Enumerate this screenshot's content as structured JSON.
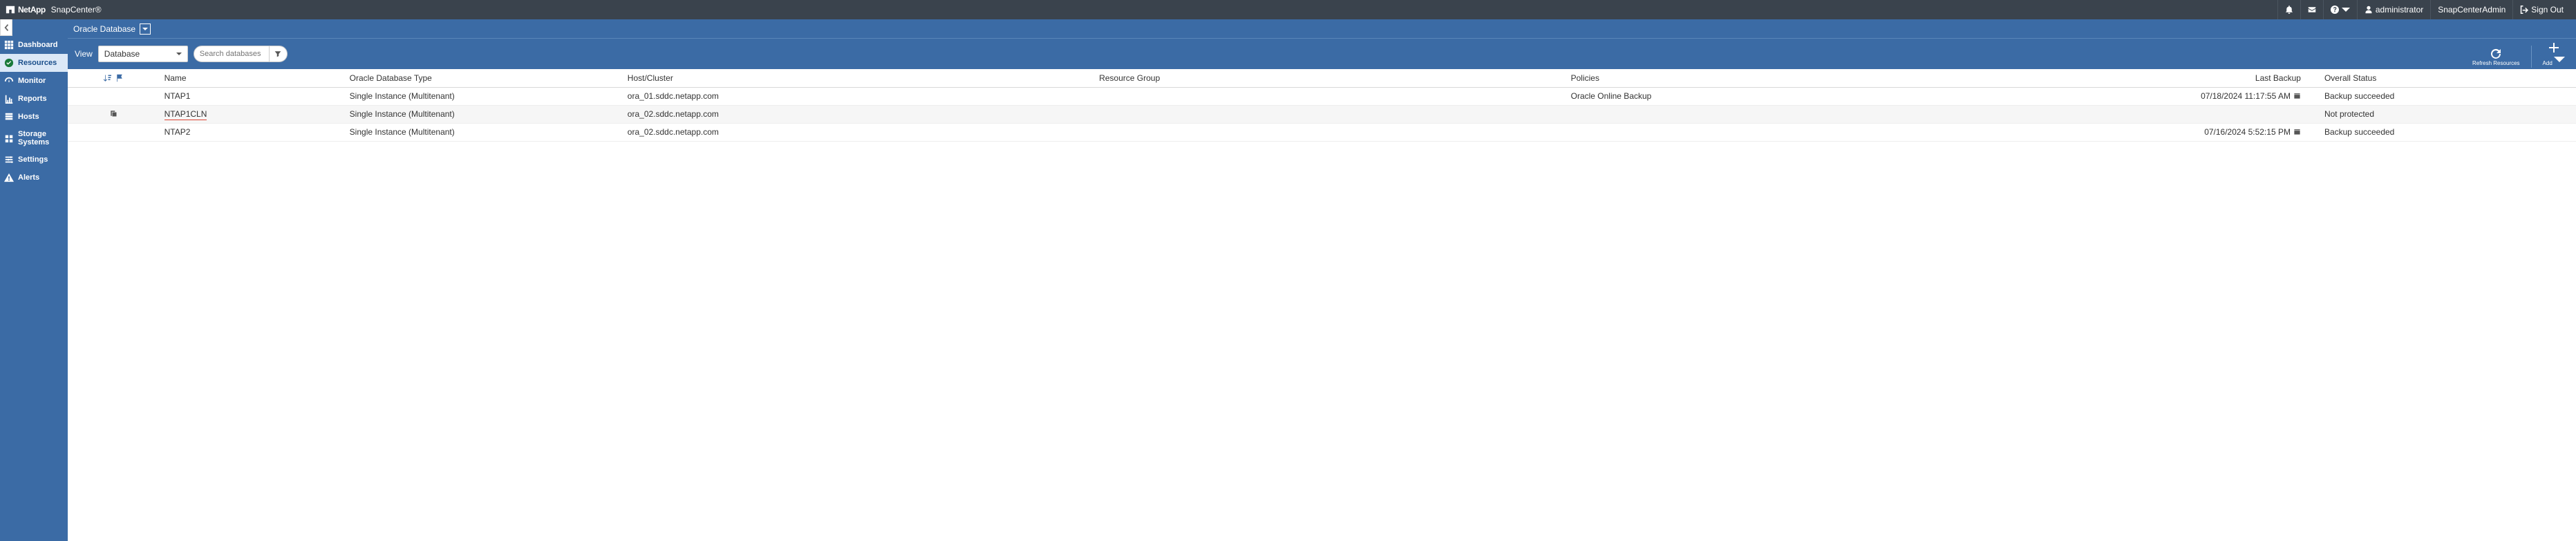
{
  "header": {
    "brand_prefix": "NetApp",
    "product": "SnapCenter®",
    "user_label": "administrator",
    "role_label": "SnapCenterAdmin",
    "signout_label": "Sign Out"
  },
  "sidebar": {
    "items": [
      {
        "id": "dashboard",
        "label": "Dashboard"
      },
      {
        "id": "resources",
        "label": "Resources"
      },
      {
        "id": "monitor",
        "label": "Monitor"
      },
      {
        "id": "reports",
        "label": "Reports"
      },
      {
        "id": "hosts",
        "label": "Hosts"
      },
      {
        "id": "storage",
        "label": "Storage Systems"
      },
      {
        "id": "settings",
        "label": "Settings"
      },
      {
        "id": "alerts",
        "label": "Alerts"
      }
    ],
    "active": "resources"
  },
  "breadcrumb": {
    "plugin": "Oracle Database"
  },
  "filterbar": {
    "view_label": "View",
    "view_value": "Database",
    "search_placeholder": "Search databases",
    "refresh_label": "Refresh Resources",
    "add_label": "Add"
  },
  "table": {
    "columns": {
      "name": "Name",
      "dbtype": "Oracle Database Type",
      "host": "Host/Cluster",
      "rg": "Resource Group",
      "policies": "Policies",
      "lastbackup": "Last Backup",
      "status": "Overall Status"
    },
    "rows": [
      {
        "row_icon": "none",
        "name": "NTAP1",
        "dbtype": "Single Instance (Multitenant)",
        "host": "ora_01.sddc.netapp.com",
        "rg": "",
        "policies": "Oracle Online Backup",
        "lastbackup": "07/18/2024 11:17:55 AM",
        "show_cal": true,
        "status": "Backup succeeded",
        "highlight_name": false
      },
      {
        "row_icon": "clone",
        "name": "NTAP1CLN",
        "dbtype": "Single Instance (Multitenant)",
        "host": "ora_02.sddc.netapp.com",
        "rg": "",
        "policies": "",
        "lastbackup": "",
        "show_cal": false,
        "status": "Not protected",
        "highlight_name": true
      },
      {
        "row_icon": "none",
        "name": "NTAP2",
        "dbtype": "Single Instance (Multitenant)",
        "host": "ora_02.sddc.netapp.com",
        "rg": "",
        "policies": "",
        "lastbackup": "07/16/2024 5:52:15 PM",
        "show_cal": true,
        "status": "Backup succeeded",
        "highlight_name": false
      }
    ]
  }
}
